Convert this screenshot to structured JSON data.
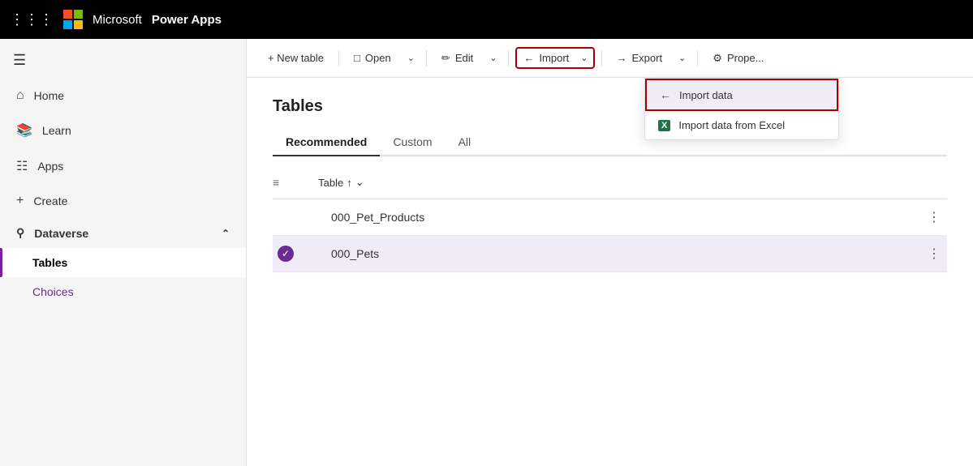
{
  "app": {
    "company": "Microsoft",
    "product": "Power Apps",
    "waffle": "⠿"
  },
  "topnav": {
    "waffle_label": "⊞"
  },
  "sidebar": {
    "hamburger_label": "☰",
    "items": [
      {
        "id": "home",
        "label": "Home",
        "icon": "⌂"
      },
      {
        "id": "learn",
        "label": "Learn",
        "icon": "📖"
      },
      {
        "id": "apps",
        "label": "Apps",
        "icon": "⊞"
      },
      {
        "id": "create",
        "label": "Create",
        "icon": "+"
      },
      {
        "id": "dataverse",
        "label": "Dataverse",
        "icon": "⊚",
        "expanded": true
      }
    ],
    "subitems": [
      {
        "id": "tables",
        "label": "Tables",
        "active": true
      },
      {
        "id": "choices",
        "label": "Choices",
        "active": false
      }
    ]
  },
  "toolbar": {
    "new_table_label": "+ New table",
    "open_label": "Open",
    "open_icon": "⊡",
    "edit_label": "Edit",
    "edit_icon": "✏",
    "import_label": "Import",
    "import_icon": "←",
    "export_label": "Export",
    "export_icon": "→",
    "properties_label": "Prope...",
    "properties_icon": "⚙",
    "caret": "∨"
  },
  "page": {
    "title": "Tables",
    "tabs": [
      {
        "id": "recommended",
        "label": "Recommended",
        "active": true
      },
      {
        "id": "custom",
        "label": "Custom",
        "active": false
      },
      {
        "id": "all",
        "label": "All",
        "active": false
      }
    ],
    "table_col_label": "Table",
    "sort_icon": "↑",
    "sort_caret": "∨",
    "rows": [
      {
        "id": "row1",
        "name": "000_Pet_Products",
        "checked": false,
        "highlighted": false
      },
      {
        "id": "row2",
        "name": "000_Pets",
        "checked": true,
        "highlighted": true
      }
    ]
  },
  "dropdown": {
    "items": [
      {
        "id": "import-data",
        "label": "Import data",
        "icon": "←",
        "highlighted": true
      },
      {
        "id": "import-excel",
        "label": "Import data from Excel",
        "icon": "X",
        "highlighted": false
      }
    ]
  }
}
